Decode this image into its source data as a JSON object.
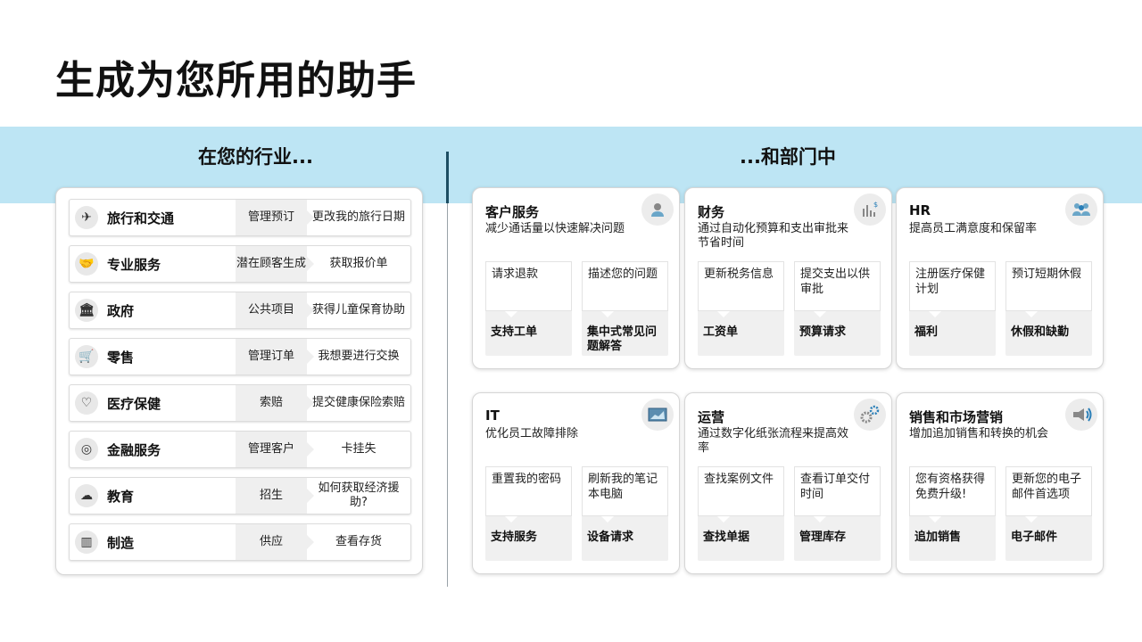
{
  "title": "生成为您所用的助手",
  "left_header": "在您的行业...",
  "right_header": "...和部门中",
  "industries": [
    {
      "name": "旅行和交通",
      "icon": "plane-icon",
      "action_a": "管理预订",
      "action_b": "更改我的旅行日期"
    },
    {
      "name": "专业服务",
      "icon": "handshake-icon",
      "action_a": "潜在顾客生成",
      "action_b": "获取报价单"
    },
    {
      "name": "政府",
      "icon": "government-building-icon",
      "action_a": "公共项目",
      "action_b": "获得儿童保育协助"
    },
    {
      "name": "零售",
      "icon": "shopping-cart-icon",
      "action_a": "管理订单",
      "action_b": "我想要进行交换"
    },
    {
      "name": "医疗保健",
      "icon": "health-heart-icon",
      "action_a": "索赔",
      "action_b": "提交健康保险索赔"
    },
    {
      "name": "金融服务",
      "icon": "finance-coin-icon",
      "action_a": "管理客户",
      "action_b": "卡挂失"
    },
    {
      "name": "教育",
      "icon": "education-cap-icon",
      "action_a": "招生",
      "action_b": "如何获取经济援助?"
    },
    {
      "name": "制造",
      "icon": "factory-icon",
      "action_a": "供应",
      "action_b": "查看存货"
    }
  ],
  "departments": [
    {
      "name": "客户服务",
      "icon": "customer-person-icon",
      "desc": "减少通话量以快速解决问题",
      "tiles": [
        {
          "top": "请求退款",
          "bottom": "支持工单"
        },
        {
          "top": "描述您的问题",
          "bottom": "集中式常见问题解答"
        }
      ]
    },
    {
      "name": "财务",
      "icon": "finance-chart-icon",
      "desc": "通过自动化预算和支出审批来节省时间",
      "tiles": [
        {
          "top": "更新税务信息",
          "bottom": "工资单"
        },
        {
          "top": "提交支出以供审批",
          "bottom": "预算请求"
        }
      ]
    },
    {
      "name": "HR",
      "icon": "people-group-icon",
      "desc": "提高员工满意度和保留率",
      "tiles": [
        {
          "top": "注册医疗保健计划",
          "bottom": "福利"
        },
        {
          "top": "预订短期休假",
          "bottom": "休假和缺勤"
        }
      ]
    },
    {
      "name": "IT",
      "icon": "monitor-chart-icon",
      "desc": "优化员工故障排除",
      "tiles": [
        {
          "top": "重置我的密码",
          "bottom": "支持服务"
        },
        {
          "top": "刷新我的笔记本电脑",
          "bottom": "设备请求"
        }
      ]
    },
    {
      "name": "运营",
      "icon": "gears-icon",
      "desc": "通过数字化纸张流程来提高效率",
      "tiles": [
        {
          "top": "查找案例文件",
          "bottom": "查找单据"
        },
        {
          "top": "查看订单交付时间",
          "bottom": "管理库存"
        }
      ]
    },
    {
      "name": "销售和市场营销",
      "icon": "megaphone-icon",
      "desc": "增加追加销售和转换的机会",
      "tiles": [
        {
          "top": "您有资格获得免费升级!",
          "bottom": "追加销售"
        },
        {
          "top": "更新您的电子邮件首选项",
          "bottom": "电子邮件"
        }
      ]
    }
  ]
}
